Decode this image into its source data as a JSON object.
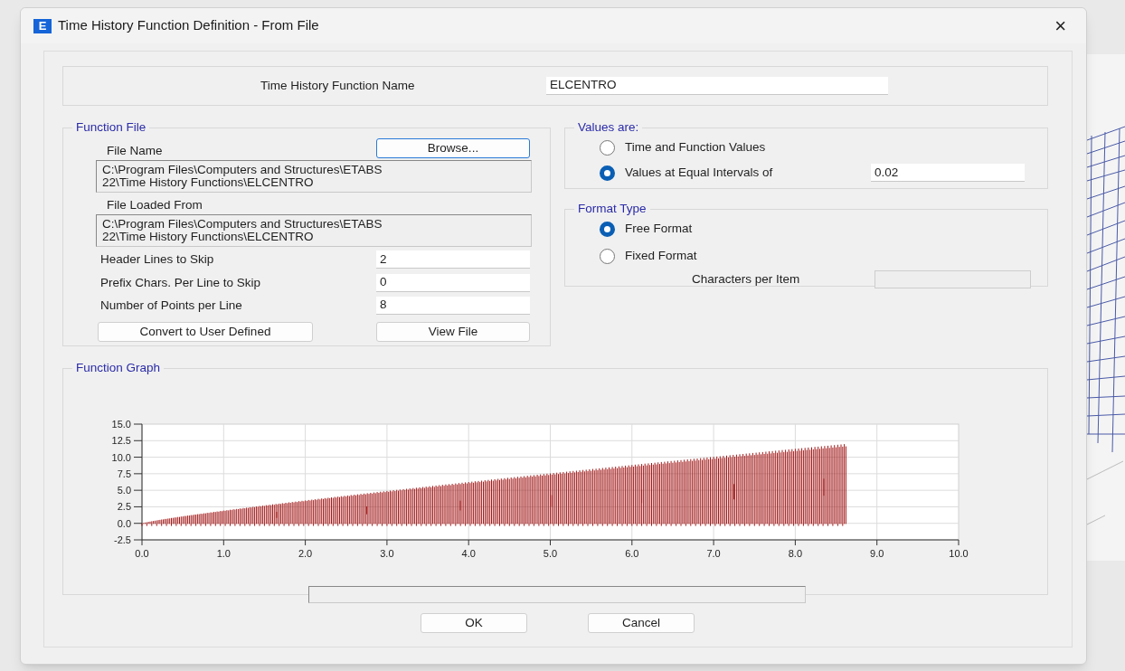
{
  "window": {
    "icon_letter": "E",
    "title": "Time History Function Definition - From File",
    "close": "×"
  },
  "function_name": {
    "label": "Time History Function Name",
    "value": "ELCENTRO"
  },
  "function_file": {
    "legend": "Function File",
    "browse_button": "Browse...",
    "file_name_label": "File Name",
    "file_name": [
      "C:\\Program Files\\Computers and Structures\\ETABS",
      "22\\Time History Functions\\ELCENTRO"
    ],
    "loaded_from_label": "File Loaded From",
    "loaded_from": [
      "C:\\Program Files\\Computers and Structures\\ETABS",
      "22\\Time History Functions\\ELCENTRO"
    ],
    "fields": [
      {
        "label": "Header Lines to Skip",
        "value": "2"
      },
      {
        "label": "Prefix Chars. Per Line to Skip",
        "value": "0"
      },
      {
        "label": "Number of Points per Line",
        "value": "8"
      }
    ],
    "buttons": [
      "Convert to User Defined",
      "View File"
    ]
  },
  "values_are": {
    "legend": "Values are:",
    "options": [
      {
        "label": "Time and Function Values",
        "selected": false
      },
      {
        "label": "Values at Equal Intervals of",
        "selected": true,
        "value": "0.02"
      }
    ]
  },
  "format_type": {
    "legend": "Format Type",
    "options": [
      {
        "label": "Free Format",
        "selected": true
      },
      {
        "label": "Fixed Format",
        "selected": false
      }
    ],
    "chars_label": "Characters per Item"
  },
  "function_graph": {
    "legend": "Function Graph",
    "y_ticks": [
      "15.0",
      "12.5",
      "10.0",
      "7.5",
      "5.0",
      "2.5",
      "0.0",
      "-2.5"
    ],
    "x_ticks": [
      "0.0",
      "1.0",
      "2.0",
      "3.0",
      "4.0",
      "5.0",
      "6.0",
      "7.0",
      "8.0",
      "9.0",
      "10.0"
    ]
  },
  "buttons": [
    "OK",
    "Cancel"
  ]
}
